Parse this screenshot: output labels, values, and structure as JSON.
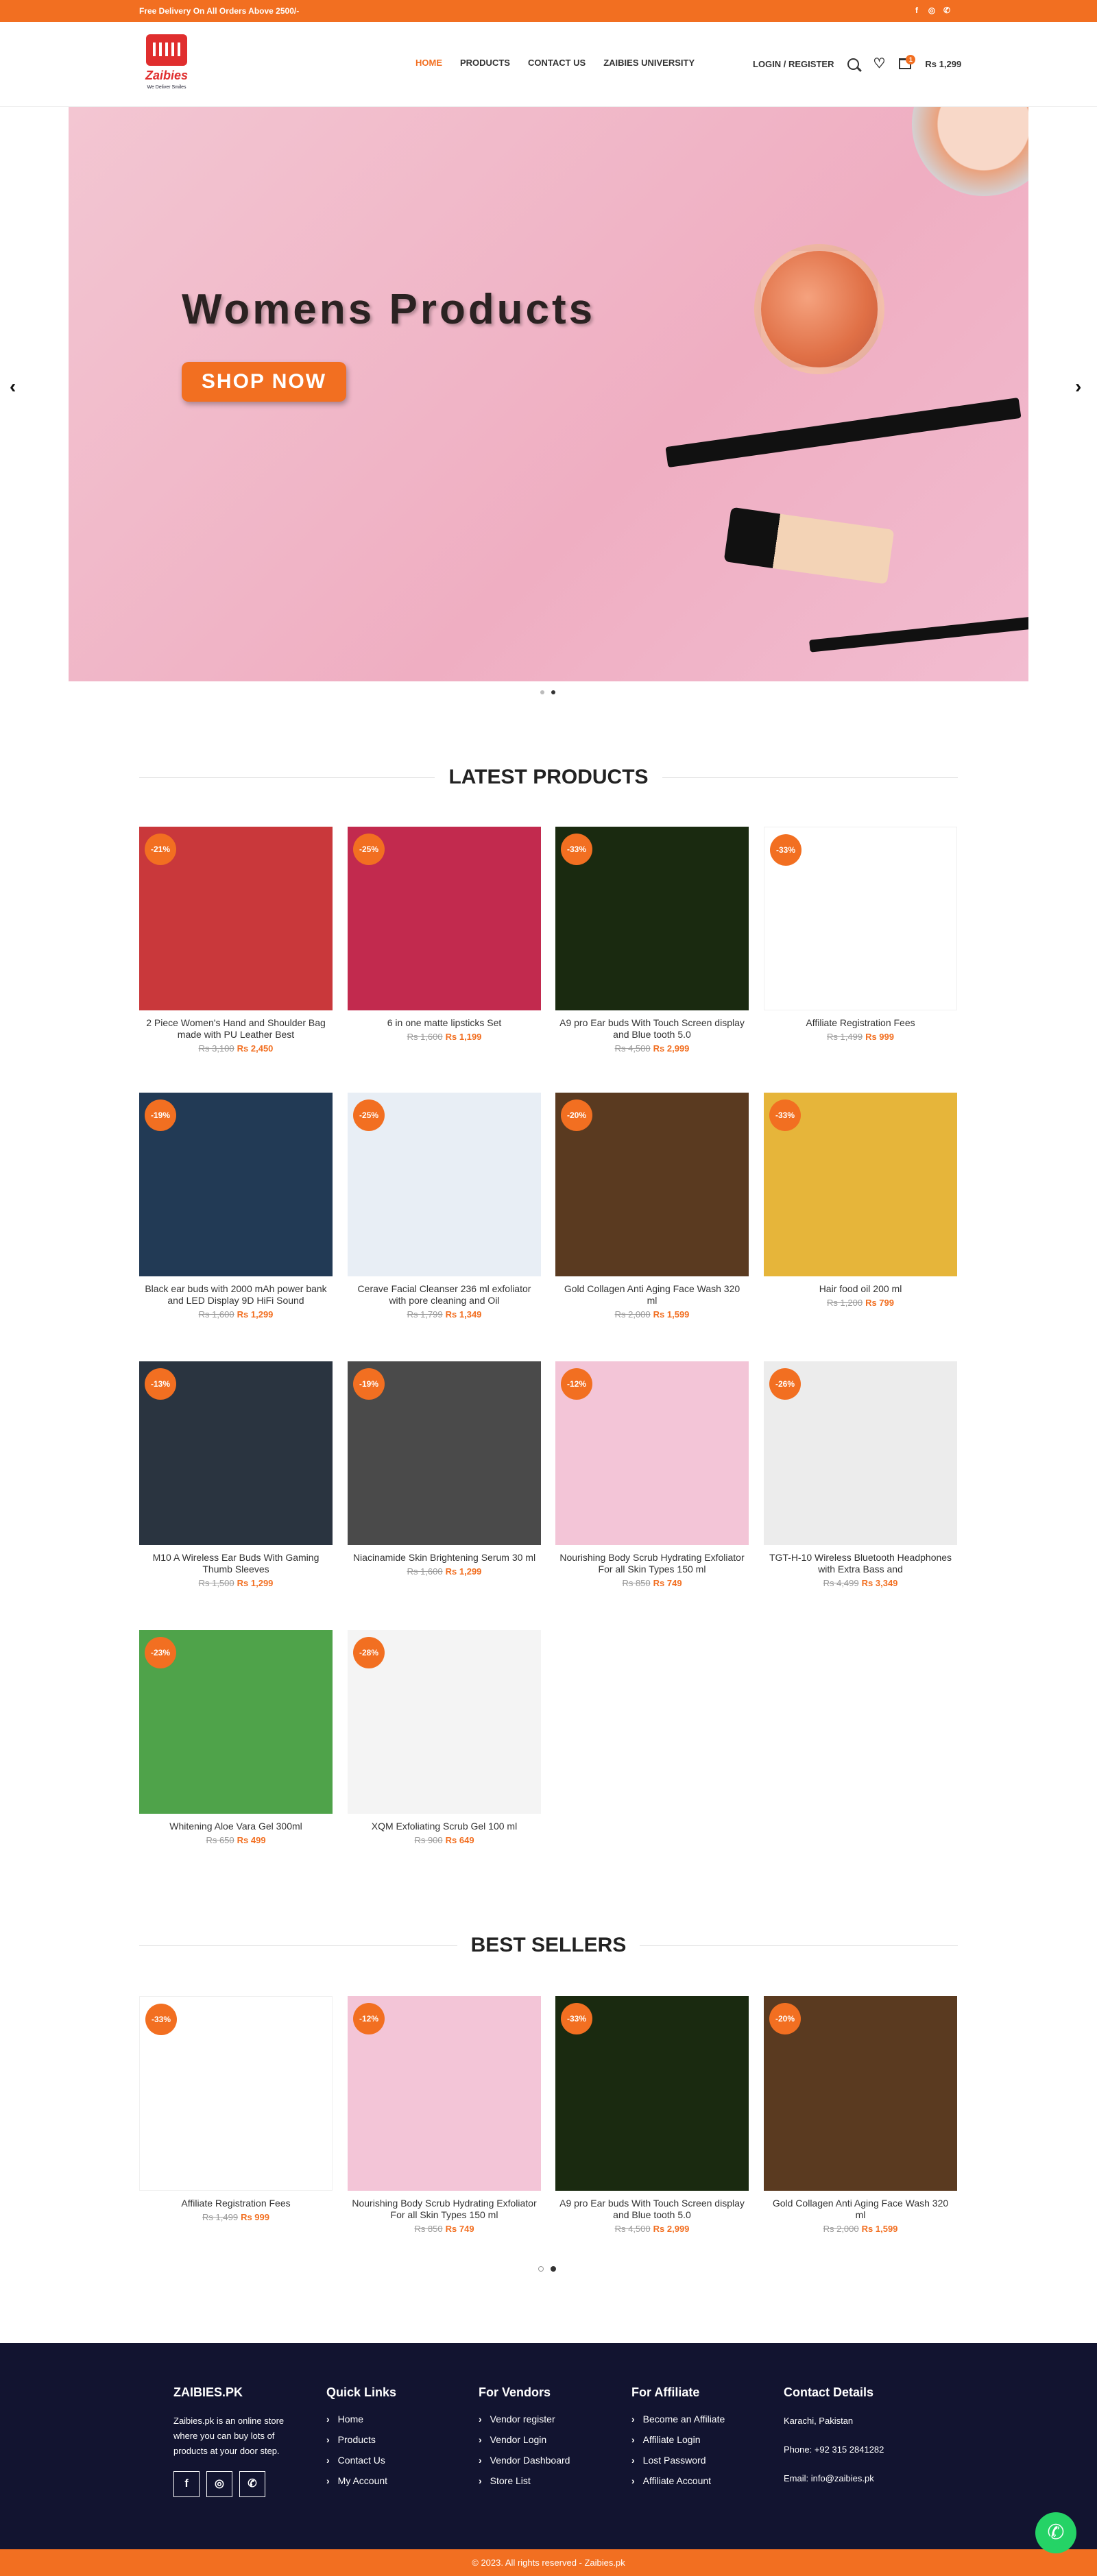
{
  "topbar": {
    "promo": "Free Delivery On All Orders Above 2500/-",
    "social": [
      "f",
      "◎",
      "✆"
    ]
  },
  "logo": {
    "brand": "Zaibies",
    "tag": "We Deliver Smiles"
  },
  "nav": [
    "HOME",
    "PRODUCTS",
    "CONTACT US",
    "ZAIBIES UNIVERSITY"
  ],
  "header": {
    "login": "LOGIN / REGISTER",
    "cart_count": "1",
    "cart_total": "Rs 1,299"
  },
  "hero": {
    "title": "Womens Products",
    "button": "SHOP NOW",
    "prev": "‹",
    "next": "›"
  },
  "latest": {
    "title": "LATEST PRODUCTS",
    "products": [
      {
        "disc": "-21%",
        "name": "2 Piece Women's Hand and Shoulder Bag made with PU Leather Best",
        "old": "Rs 3,100",
        "new": "Rs 2,450",
        "color": "#c9383b"
      },
      {
        "disc": "-25%",
        "name": "6 in one matte lipsticks Set",
        "old": "Rs 1,600",
        "new": "Rs 1,199",
        "color": "#c22a4e"
      },
      {
        "disc": "-33%",
        "name": "A9 pro Ear buds With Touch Screen display and Blue tooth 5.0",
        "old": "Rs 4,500",
        "new": "Rs 2,999",
        "color": "#1a2a10"
      },
      {
        "disc": "-33%",
        "name": "Affiliate Registration Fees",
        "old": "Rs 1,499",
        "new": "Rs 999",
        "color": "#ffffff"
      },
      {
        "disc": "-19%",
        "name": "Black ear buds with 2000 mAh power bank and LED Display 9D HiFi Sound",
        "old": "Rs 1,600",
        "new": "Rs 1,299",
        "color": "#223a55"
      },
      {
        "disc": "-25%",
        "name": "Cerave Facial Cleanser 236 ml exfoliator with pore cleaning and Oil",
        "old": "Rs 1,799",
        "new": "Rs 1,349",
        "color": "#e8eef5"
      },
      {
        "disc": "-20%",
        "name": "Gold Collagen Anti Aging Face Wash 320 ml",
        "old": "Rs 2,000",
        "new": "Rs 1,599",
        "color": "#5a3a20"
      },
      {
        "disc": "-33%",
        "name": "Hair food oil 200 ml",
        "old": "Rs 1,200",
        "new": "Rs 799",
        "color": "#e6b53a"
      },
      {
        "disc": "-13%",
        "name": "M10 A Wireless Ear Buds With Gaming Thumb Sleeves",
        "old": "Rs 1,500",
        "new": "Rs 1,299",
        "color": "#2a3440"
      },
      {
        "disc": "-19%",
        "name": "Niacinamide Skin Brightening Serum 30 ml",
        "old": "Rs 1,600",
        "new": "Rs 1,299",
        "color": "#4a4a4a"
      },
      {
        "disc": "-12%",
        "name": "Nourishing Body Scrub Hydrating Exfoliator For all Skin Types 150 ml",
        "old": "Rs 850",
        "new": "Rs 749",
        "color": "#f3c5d7"
      },
      {
        "disc": "-26%",
        "name": "TGT-H-10 Wireless Bluetooth Headphones with Extra Bass and",
        "old": "Rs 4,499",
        "new": "Rs 3,349",
        "color": "#ececec"
      },
      {
        "disc": "-23%",
        "name": "Whitening Aloe Vara Gel 300ml",
        "old": "Rs 650",
        "new": "Rs 499",
        "color": "#4fa34a"
      },
      {
        "disc": "-28%",
        "name": "XQM Exfoliating Scrub Gel 100 ml",
        "old": "Rs 900",
        "new": "Rs 649",
        "color": "#f4f4f4"
      }
    ]
  },
  "best": {
    "title": "BEST SELLERS",
    "products": [
      {
        "disc": "-33%",
        "name": "Affiliate Registration Fees",
        "old": "Rs 1,499",
        "new": "Rs 999",
        "color": "#ffffff"
      },
      {
        "disc": "-12%",
        "name": "Nourishing Body Scrub Hydrating Exfoliator For all Skin Types 150 ml",
        "old": "Rs 850",
        "new": "Rs 749",
        "color": "#f3c5d7"
      },
      {
        "disc": "-33%",
        "name": "A9 pro Ear buds With Touch Screen display and Blue tooth 5.0",
        "old": "Rs 4,500",
        "new": "Rs 2,999",
        "color": "#1a2a10"
      },
      {
        "disc": "-20%",
        "name": "Gold Collagen Anti Aging Face Wash 320 ml",
        "old": "Rs 2,000",
        "new": "Rs 1,599",
        "color": "#5a3a20"
      }
    ]
  },
  "footer": {
    "about": {
      "title": "ZAIBIES.PK",
      "text": "Zaibies.pk is an online store where you can buy lots of products at your door step.",
      "social": [
        "f",
        "◎",
        "✆"
      ]
    },
    "quick": {
      "title": "Quick Links",
      "items": [
        "Home",
        "Products",
        "Contact Us",
        "My Account"
      ]
    },
    "vendors": {
      "title": "For Vendors",
      "items": [
        "Vendor register",
        "Vendor Login",
        "Vendor Dashboard",
        "Store List"
      ]
    },
    "affiliate": {
      "title": "For Affiliate",
      "items": [
        "Become an Affiliate",
        "Affiliate Login",
        "Lost Password",
        "Affiliate Account"
      ]
    },
    "contact": {
      "title": "Contact Details",
      "lines": [
        "Karachi, Pakistan",
        "Phone: +92 315 2841282",
        "Email: info@zaibies.pk"
      ]
    },
    "copyright": "© 2023. All rights reserved - Zaibies.pk"
  },
  "whatsapp": "✆"
}
